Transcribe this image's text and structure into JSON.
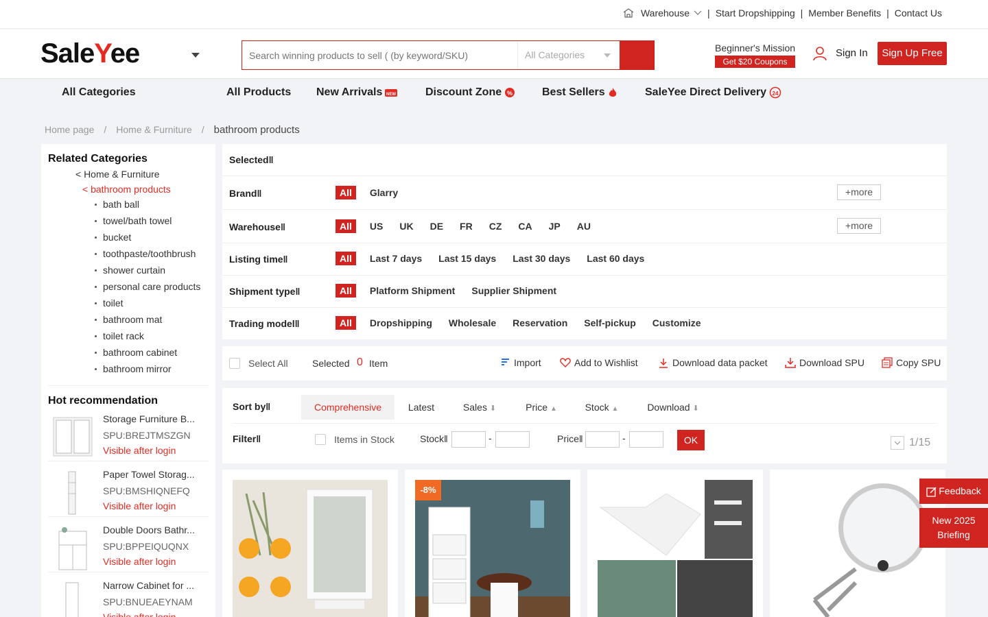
{
  "topbar": {
    "warehouse": "Warehouse",
    "start": "Start Dropshipping",
    "member": "Member Benefits",
    "contact": "Contact Us"
  },
  "header": {
    "logo_a": "Sale",
    "logo_b": "Y",
    "logo_c": "ee",
    "search_placeholder": "Search winning products to sell ( (by keyword/SKU)",
    "search_category": "All Categories",
    "mission": "Beginner's Mission",
    "coupon": "Get $20 Coupons",
    "signin": "Sign In",
    "signup": "Sign Up Free"
  },
  "nav": {
    "all_categories": "All Categories",
    "items": [
      "All Products",
      "New Arrivals",
      "Discount Zone",
      "Best Sellers",
      "SaleYee Direct Delivery"
    ]
  },
  "breadcrumb": [
    "Home page",
    "Home & Furniture",
    "bathroom products"
  ],
  "sidebar": {
    "related_title": "Related Categories",
    "parent": "< Home & Furniture",
    "current": "< bathroom products",
    "subcats": [
      "bath ball",
      "towel/bath towel",
      "bucket",
      "toothpaste/toothbrush",
      "shower curtain",
      "personal care products",
      "toilet",
      "bathroom mat",
      "toilet rack",
      "bathroom cabinet",
      "bathroom mirror"
    ],
    "hot_title": "Hot recommendation",
    "hot": [
      {
        "name": "Storage Furniture B...",
        "spu": "SPU:BREJTMSZGN",
        "vis": "Visible after login"
      },
      {
        "name": "Paper Towel Storag...",
        "spu": "SPU:BMSHIQNEFQ",
        "vis": "Visible after login"
      },
      {
        "name": "Double Doors Bathr...",
        "spu": "SPU:BPPEIQUQNX",
        "vis": "Visible after login"
      },
      {
        "name": "Narrow Cabinet for ...",
        "spu": "SPU:BNUEAEYNAM",
        "vis": "Visible after login"
      }
    ]
  },
  "filters": {
    "selected": "Selected‖",
    "all": "All",
    "more": "more",
    "brand": {
      "label": "Brand‖",
      "opts": [
        "Glarry"
      ]
    },
    "warehouse": {
      "label": "Warehouse‖",
      "opts": [
        "US",
        "UK",
        "DE",
        "FR",
        "CZ",
        "CA",
        "JP",
        "AU"
      ]
    },
    "listing": {
      "label": "Listing time‖",
      "opts": [
        "Last 7 days",
        "Last 15 days",
        "Last 30 days",
        "Last 60 days"
      ]
    },
    "shipment": {
      "label": "Shipment type‖",
      "opts": [
        "Platform Shipment",
        "Supplier Shipment"
      ]
    },
    "trading": {
      "label": "Trading model‖",
      "opts": [
        "Dropshipping",
        "Wholesale",
        "Reservation",
        "Self-pickup",
        "Customize"
      ]
    }
  },
  "actionbar": {
    "select_all": "Select All",
    "selected": "Selected",
    "count": "0",
    "item": "Item",
    "import": "Import",
    "wishlist": "Add to Wishlist",
    "download_packet": "Download data packet",
    "download_spu": "Download SPU",
    "copy_spu": "Copy SPU"
  },
  "sort": {
    "label": "Sort by‖",
    "options": [
      "Comprehensive",
      "Latest",
      "Sales",
      "Price",
      "Stock",
      "Download"
    ],
    "filter_label": "Filter‖",
    "in_stock": "Items in Stock",
    "stock": "Stock‖",
    "price": "Price‖",
    "ok": "OK",
    "page": "1/15"
  },
  "products": [
    {
      "discount": ""
    },
    {
      "discount": "-8%"
    },
    {
      "discount": ""
    },
    {
      "discount": ""
    }
  ],
  "float": {
    "feedback": "Feedback",
    "briefing_1": "New 2025",
    "briefing_2": "Briefing"
  },
  "colors": {
    "brand": "#cf2420"
  }
}
